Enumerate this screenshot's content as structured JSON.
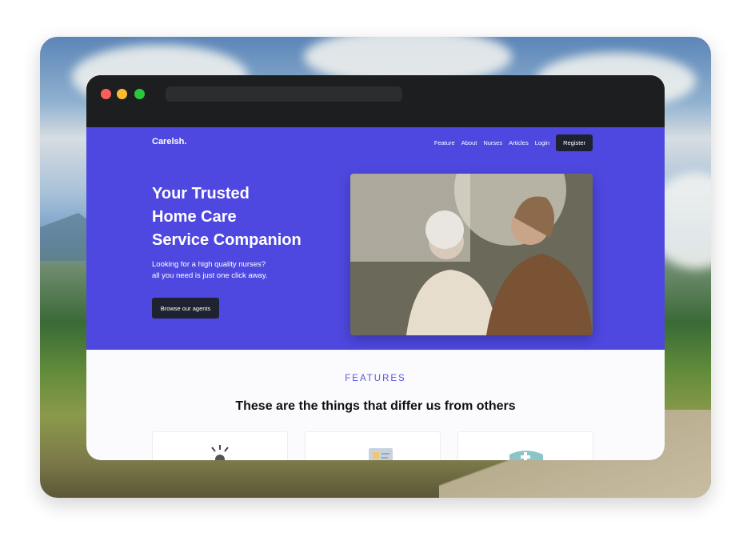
{
  "browser": {
    "url": ""
  },
  "header": {
    "brand": "Carelsh.",
    "nav": [
      "Feature",
      "About",
      "Nurses",
      "Articles",
      "Login"
    ],
    "register_label": "Register"
  },
  "hero": {
    "title_lines": [
      "Your Trusted",
      "Home Care",
      "Service Companion"
    ],
    "subtitle_lines": [
      "Looking for a high quality nurses?",
      "all you need is just one click away."
    ],
    "cta_label": "Browse our agents"
  },
  "features": {
    "label": "FEATURES",
    "title": "These are the things that differ us from others",
    "cards": [
      {
        "icon": "sun-rays-icon"
      },
      {
        "icon": "id-card-icon"
      },
      {
        "icon": "medical-kit-icon"
      }
    ]
  },
  "colors": {
    "hero_bg": "#4e48e0",
    "accent": "#5a55e3",
    "dark_button": "#1f2230"
  }
}
